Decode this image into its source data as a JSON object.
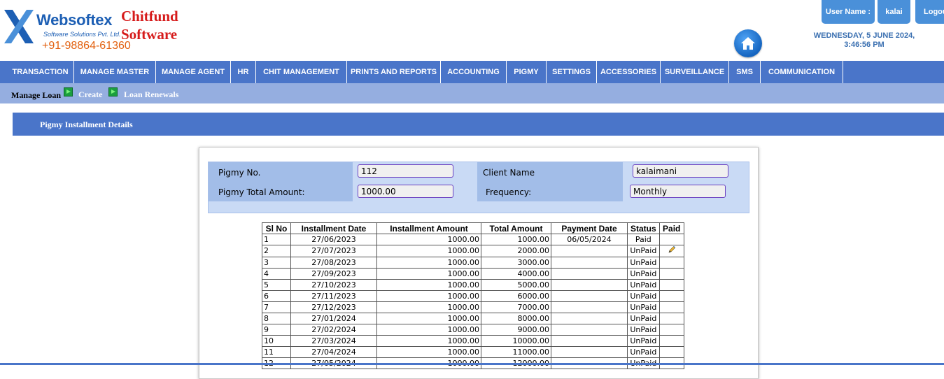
{
  "brand": {
    "name": "Websoftex",
    "subtitle": "Software Solutions Pvt. Ltd.",
    "phone": "+91-98864-61360",
    "product_line1": "Chitfund",
    "product_line2": "Software"
  },
  "user": {
    "label": "User Name :",
    "name": "kalai",
    "logout": "Logout"
  },
  "datetime": {
    "date": "WEDNESDAY, 5 JUNE 2024,",
    "time": "3:46:56 PM"
  },
  "menu": [
    "TRANSACTION",
    "MANAGE MASTER",
    "MANAGE AGENT",
    "HR",
    "CHIT MANAGEMENT",
    "PRINTS AND REPORTS",
    "ACCOUNTING",
    "PIGMY",
    "SETTINGS",
    "ACCESSORIES",
    "SURVEILLANCE",
    "SMS",
    "COMMUNICATION"
  ],
  "submenu": {
    "manage_loan": "Manage Loan",
    "create": "Create",
    "loan_renewals": "Loan Renewals"
  },
  "section_title": "Pigmy Installment Details",
  "form": {
    "pigmy_no_label": "Pigmy No.",
    "pigmy_no_value": "112",
    "client_name_label": "Client Name",
    "client_name_value": "kalaimani",
    "total_amount_label": "Pigmy Total Amount:",
    "total_amount_value": "1000.00",
    "frequency_label": "Frequency:",
    "frequency_value": "Monthly"
  },
  "table": {
    "headers": [
      "Sl No",
      "Installment Date",
      "Installment Amount",
      "Total Amount",
      "Payment Date",
      "Status",
      "Paid"
    ],
    "rows": [
      {
        "sl": "1",
        "date": "27/06/2023",
        "amount": "1000.00",
        "total": "1000.00",
        "payment_date": "06/05/2024",
        "status": "Paid"
      },
      {
        "sl": "2",
        "date": "27/07/2023",
        "amount": "1000.00",
        "total": "2000.00",
        "payment_date": "",
        "status": "UnPaid"
      },
      {
        "sl": "3",
        "date": "27/08/2023",
        "amount": "1000.00",
        "total": "3000.00",
        "payment_date": "",
        "status": "UnPaid"
      },
      {
        "sl": "4",
        "date": "27/09/2023",
        "amount": "1000.00",
        "total": "4000.00",
        "payment_date": "",
        "status": "UnPaid"
      },
      {
        "sl": "5",
        "date": "27/10/2023",
        "amount": "1000.00",
        "total": "5000.00",
        "payment_date": "",
        "status": "UnPaid"
      },
      {
        "sl": "6",
        "date": "27/11/2023",
        "amount": "1000.00",
        "total": "6000.00",
        "payment_date": "",
        "status": "UnPaid"
      },
      {
        "sl": "7",
        "date": "27/12/2023",
        "amount": "1000.00",
        "total": "7000.00",
        "payment_date": "",
        "status": "UnPaid"
      },
      {
        "sl": "8",
        "date": "27/01/2024",
        "amount": "1000.00",
        "total": "8000.00",
        "payment_date": "",
        "status": "UnPaid"
      },
      {
        "sl": "9",
        "date": "27/02/2024",
        "amount": "1000.00",
        "total": "9000.00",
        "payment_date": "",
        "status": "UnPaid"
      },
      {
        "sl": "10",
        "date": "27/03/2024",
        "amount": "1000.00",
        "total": "10000.00",
        "payment_date": "",
        "status": "UnPaid"
      },
      {
        "sl": "11",
        "date": "27/04/2024",
        "amount": "1000.00",
        "total": "11000.00",
        "payment_date": "",
        "status": "UnPaid"
      },
      {
        "sl": "12",
        "date": "27/05/2024",
        "amount": "1000.00",
        "total": "12000.00",
        "payment_date": "",
        "status": "UnPaid"
      }
    ]
  },
  "colors": {
    "menu_bg": "#4a75c9",
    "submenu_bg": "#95aee0",
    "brand_blue": "#1d5fb4",
    "brand_red": "#d61b1b",
    "phone_orange": "#e2600f"
  }
}
